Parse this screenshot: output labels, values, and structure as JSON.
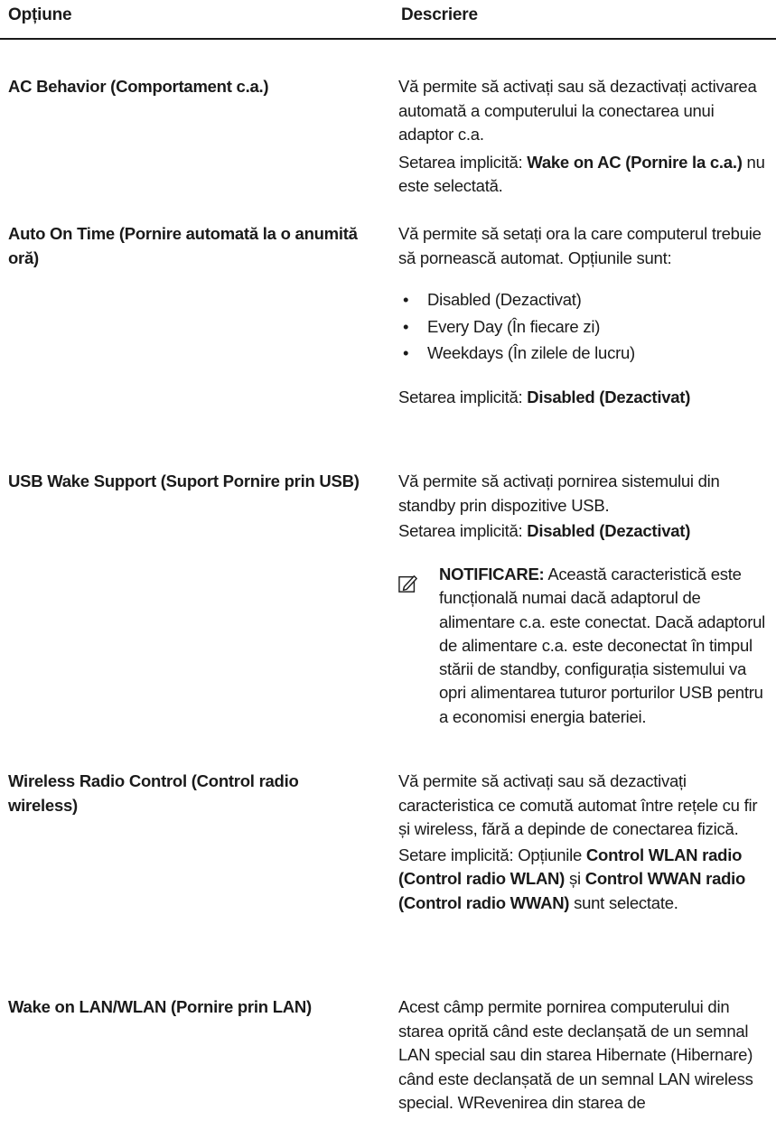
{
  "header": {
    "option": "Opțiune",
    "description": "Descriere"
  },
  "rows": [
    {
      "option": "AC Behavior (Comportament c.a.)",
      "desc": "Vă permite să activați sau să dezactivați activarea automată a computerului la conectarea unui adaptor c.a.",
      "default_prefix": "Setarea implicită: ",
      "default_value": "Wake on AC (Pornire la c.a.)",
      "default_suffix": " nu este selectată."
    },
    {
      "option": "Auto On Time (Pornire automată la o anumită oră)",
      "desc": "Vă permite să setați ora la care computerul trebuie să pornească automat. Opțiunile sunt:",
      "options": [
        "Disabled (Dezactivat)",
        "Every Day (În fiecare zi)",
        "Weekdays (În zilele de lucru)"
      ],
      "default_prefix": "Setarea implicită: ",
      "default_value": "Disabled (Dezactivat)"
    },
    {
      "option": "USB Wake Support (Suport Pornire prin USB)",
      "desc": "Vă permite să activați pornirea sistemului din standby prin dispozitive USB.",
      "default_prefix": "Setarea implicită: ",
      "default_value": "Disabled (Dezactivat)",
      "note_label": "NOTIFICARE:",
      "note_text": " Această caracteristică este funcțională numai dacă adaptorul de alimentare c.a. este conectat. Dacă adaptorul de alimentare c.a. este deconectat în timpul stării de standby, configurația sistemului va opri alimentarea tuturor porturilor USB pentru a economisi energia bateriei."
    },
    {
      "option": "Wireless Radio Control (Control radio wireless)",
      "desc": "Vă permite să activați sau să dezactivați caracteristica ce comută automat între rețele cu fir și wireless, fără a depinde de conectarea fizică.",
      "default_prefix": "Setare implicită: Opțiunile ",
      "default_value": "Control WLAN radio (Control radio WLAN)",
      "default_mid": " și ",
      "default_value2": "Control WWAN radio (Control radio WWAN)",
      "default_suffix": " sunt selectate."
    },
    {
      "option": "Wake on LAN/WLAN (Pornire prin LAN)",
      "desc": "Acest câmp permite pornirea computerului din starea oprită când este declanșată de un semnal LAN special sau din starea Hibernate (Hibernare) când este declanșată de un semnal LAN wireless special. WRevenirea din starea de"
    }
  ]
}
